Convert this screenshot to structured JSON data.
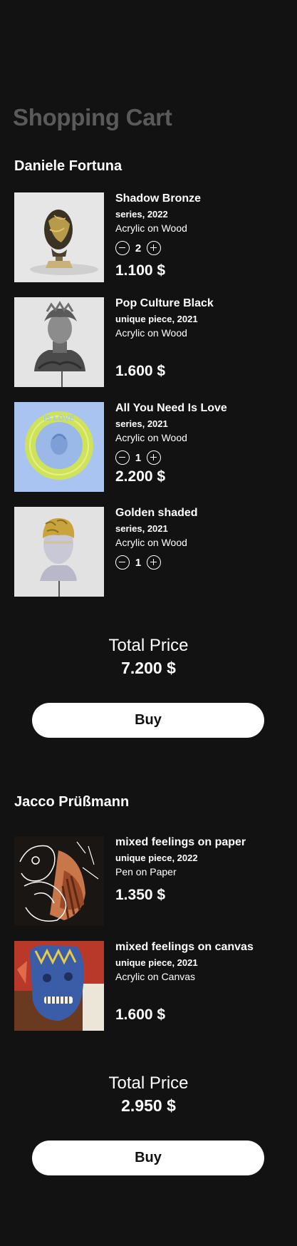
{
  "page_title": "Shopping Cart",
  "colors": {
    "background": "#121212",
    "title": "#5a5a5a",
    "text": "#ffffff",
    "button_bg": "#ffffff",
    "button_text": "#111111"
  },
  "groups": [
    {
      "artist": "Daniele Fortuna",
      "items": [
        {
          "title": "Shadow Bronze",
          "meta": "series, 2022",
          "medium": "Acrylic on Wood",
          "quantity": "2",
          "price": "1.100 $",
          "image_icon": "bronze-bust-image"
        },
        {
          "title": "Pop Culture Black",
          "meta": "unique piece, 2021",
          "medium": "Acrylic on Wood",
          "price": "1.600 $",
          "image_icon": "black-bust-image"
        },
        {
          "title": "All You Need Is Love",
          "meta": "series, 2021",
          "medium": "Acrylic on Wood",
          "quantity": "1",
          "price": "2.200 $",
          "image_icon": "love-medallion-image"
        },
        {
          "title": "Golden shaded",
          "meta": "series, 2021",
          "medium": "Acrylic on Wood",
          "quantity": "1",
          "image_icon": "golden-head-image"
        }
      ],
      "total_label": "Total Price",
      "total_value": "7.200 $",
      "buy_label": "Buy"
    },
    {
      "artist": "Jacco Prüßmann",
      "items": [
        {
          "title": "mixed feelings on paper",
          "meta": "unique piece, 2022",
          "medium": "Pen on Paper",
          "price": "1.350 $",
          "image_icon": "line-drawing-image"
        },
        {
          "title": "mixed feelings on canvas",
          "meta": "unique piece, 2021",
          "medium": "Acrylic on Canvas",
          "price": "1.600 $",
          "image_icon": "blue-face-painting-image"
        }
      ],
      "total_label": "Total Price",
      "total_value": "2.950 $",
      "buy_label": "Buy"
    }
  ]
}
